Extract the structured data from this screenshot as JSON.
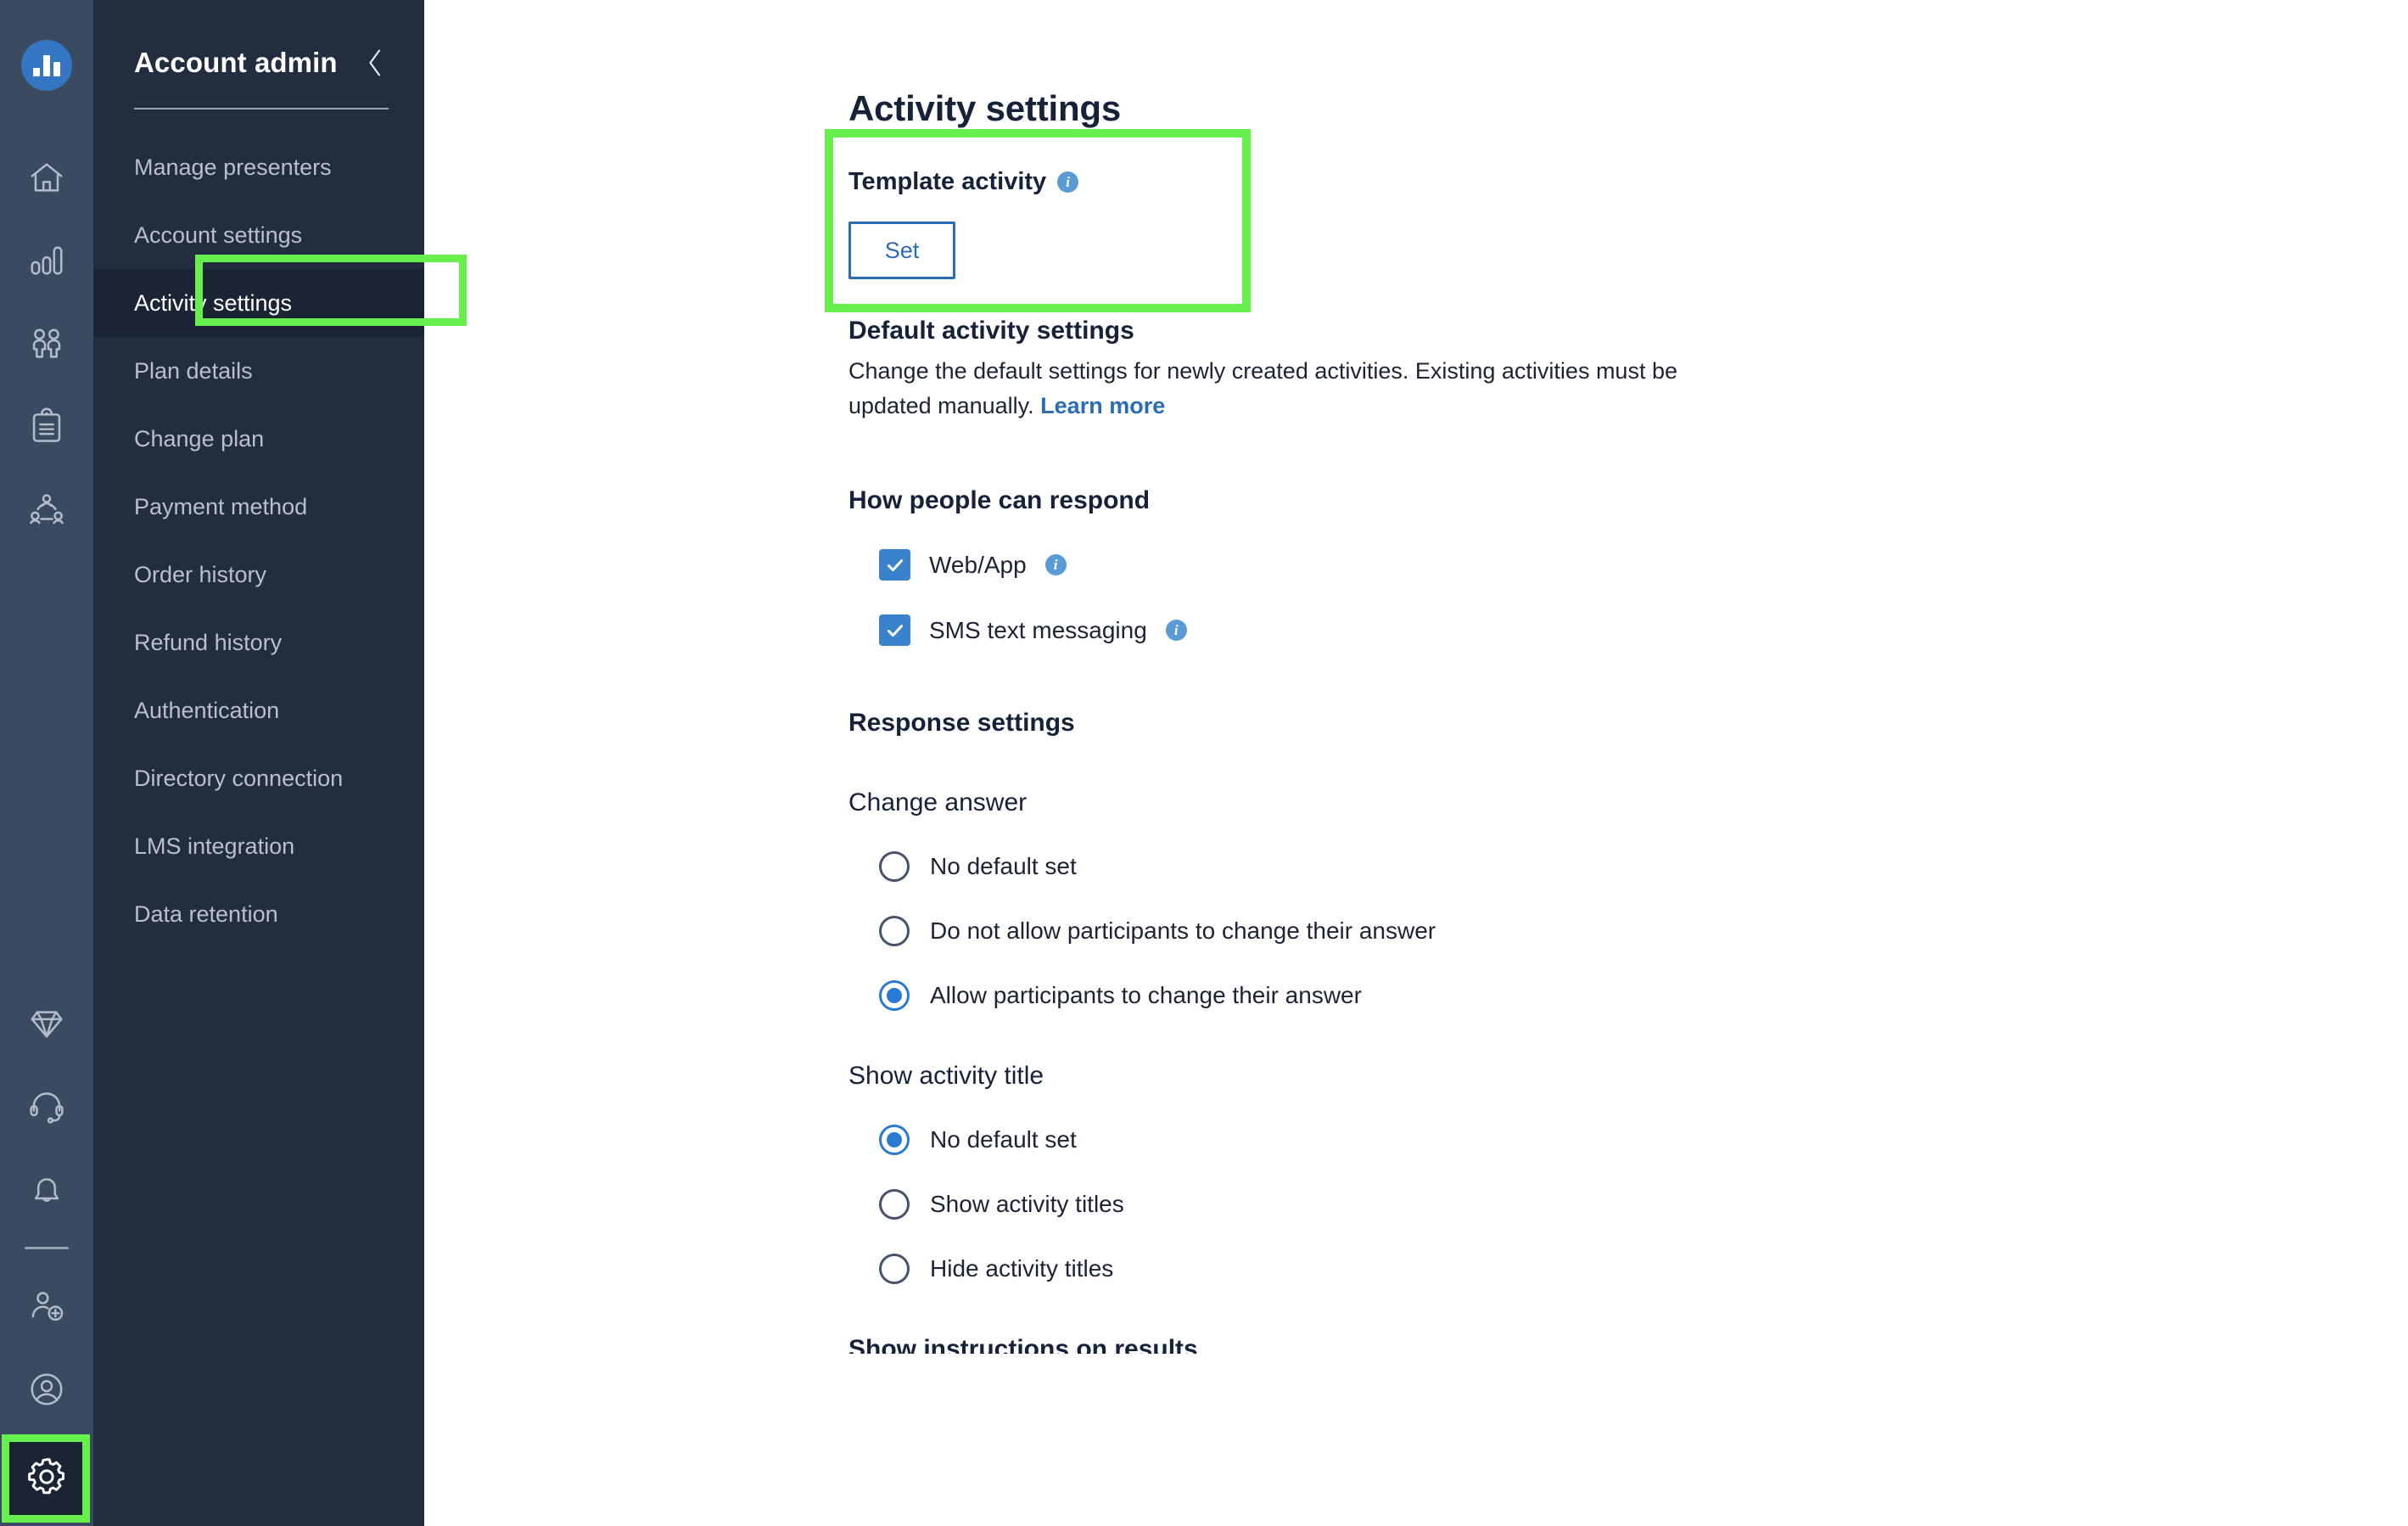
{
  "brand": {
    "logo_name": "bar-chart-logo",
    "accent_blue": "#3476c4",
    "highlight_green": "#66ef4d",
    "rail_bg": "#394a61",
    "nav_bg": "#222d40",
    "nav_active_bg": "#1b2433"
  },
  "icon_rail": {
    "top_items": [
      {
        "name": "home-icon",
        "label": "Home"
      },
      {
        "name": "bar-chart-icon",
        "label": "Analytics"
      },
      {
        "name": "people-icon",
        "label": "Participants"
      },
      {
        "name": "clipboard-icon",
        "label": "Activities"
      },
      {
        "name": "network-people-icon",
        "label": "Teams"
      }
    ],
    "bottom_items": [
      {
        "name": "diamond-icon",
        "label": "Upgrade"
      },
      {
        "name": "headset-icon",
        "label": "Support"
      },
      {
        "name": "bell-icon",
        "label": "Notifications"
      },
      {
        "name": "add-person-icon",
        "label": "Invite"
      },
      {
        "name": "user-profile-icon",
        "label": "Profile"
      },
      {
        "name": "gear-icon",
        "label": "Settings"
      }
    ]
  },
  "nav": {
    "title": "Account admin",
    "collapse_icon": "chevron-left-icon",
    "active_item": "Activity settings",
    "items": [
      {
        "label": "Manage presenters",
        "active": false
      },
      {
        "label": "Account settings",
        "active": false
      },
      {
        "label": "Activity settings",
        "active": true
      },
      {
        "label": "Plan details",
        "active": false
      },
      {
        "label": "Change plan",
        "active": false
      },
      {
        "label": "Payment method",
        "active": false
      },
      {
        "label": "Order history",
        "active": false
      },
      {
        "label": "Refund history",
        "active": false
      },
      {
        "label": "Authentication",
        "active": false
      },
      {
        "label": "Directory connection",
        "active": false
      },
      {
        "label": "LMS integration",
        "active": false
      },
      {
        "label": "Data retention",
        "active": false
      }
    ]
  },
  "main": {
    "page_title": "Activity settings",
    "template_activity": {
      "label": "Template activity",
      "info_icon": "info-icon",
      "info_glyph": "i",
      "set_button": "Set"
    },
    "default_settings": {
      "title": "Default activity settings",
      "description": "Change the default settings for newly created activities. Existing activities must be updated manually.",
      "link_text": "Learn more"
    },
    "how_people_respond": {
      "heading": "How people can respond",
      "options": [
        {
          "label": "Web/App",
          "checked": true,
          "info": true
        },
        {
          "label": "SMS text messaging",
          "checked": true,
          "info": true
        }
      ]
    },
    "response_settings": {
      "heading": "Response settings",
      "groups": [
        {
          "label": "Change answer",
          "options": [
            {
              "label": "No default set",
              "selected": false
            },
            {
              "label": "Do not allow participants to change their answer",
              "selected": false
            },
            {
              "label": "Allow participants to change their answer",
              "selected": true
            }
          ]
        },
        {
          "label": "Show activity title",
          "options": [
            {
              "label": "No default set",
              "selected": true
            },
            {
              "label": "Show activity titles",
              "selected": false
            },
            {
              "label": "Hide activity titles",
              "selected": false
            }
          ]
        }
      ],
      "cut_off_heading": "Show instructions on results"
    }
  }
}
